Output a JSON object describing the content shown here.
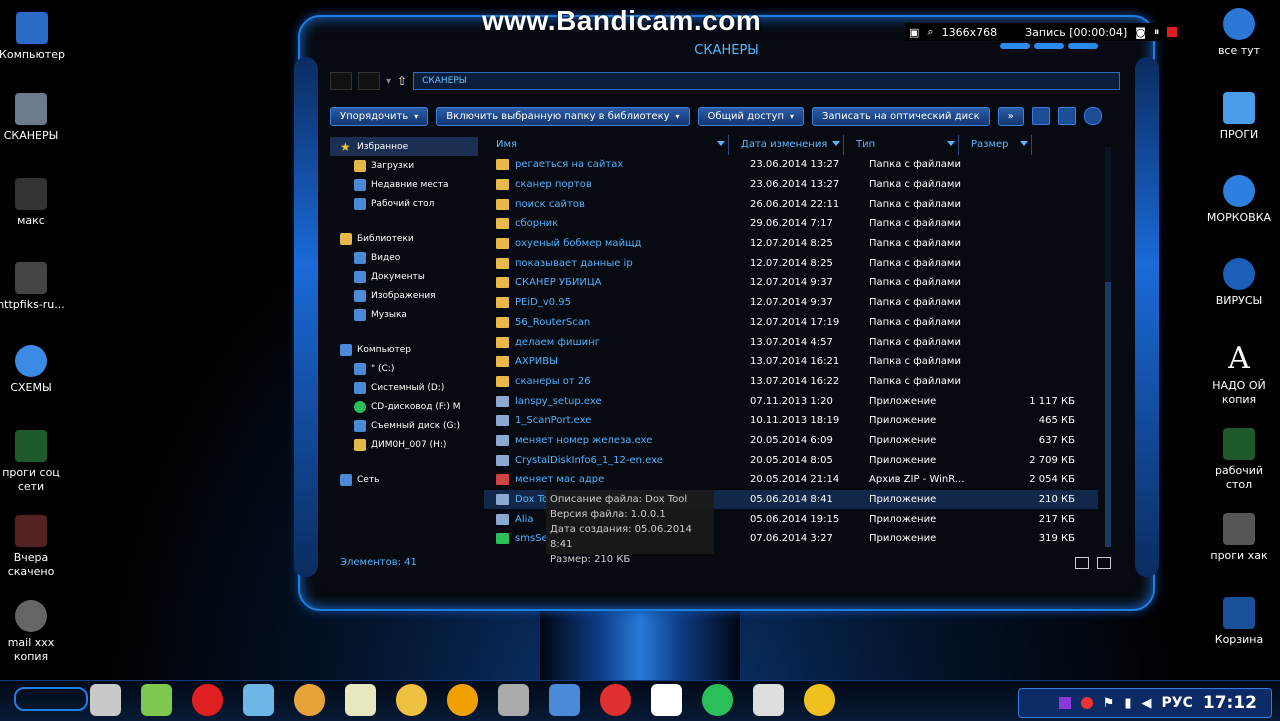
{
  "overlay": {
    "watermark": "www.Bandicam.com",
    "resolution": "1366x768",
    "recording": "Запись [00:00:04]"
  },
  "desktop_left": [
    {
      "label": "Компьютер",
      "icon": "computer-icon"
    },
    {
      "label": "СКАНЕРЫ",
      "icon": "folder-icon"
    },
    {
      "label": "макс",
      "icon": "folder-icon"
    },
    {
      "label": "httpfiks-ru...",
      "icon": "tool-icon"
    },
    {
      "label": "СХЕМЫ",
      "icon": "globe-icon"
    },
    {
      "label": "проги соц сети",
      "icon": "folder-icon"
    },
    {
      "label": "Вчера скачено",
      "icon": "folder-icon"
    },
    {
      "label": "mail xxx копия",
      "icon": "mail-icon"
    }
  ],
  "desktop_right": [
    {
      "label": "все тут",
      "icon": "windows-icon"
    },
    {
      "label": "ПРОГИ",
      "icon": "monitor-icon"
    },
    {
      "label": "МОРКОВКА",
      "icon": "globe-icon"
    },
    {
      "label": "ВИРУСЫ",
      "icon": "globe-icon"
    },
    {
      "label": "НАДО ОЙ копия",
      "icon": "font-icon"
    },
    {
      "label": "рабочий стол",
      "icon": "folder-icon"
    },
    {
      "label": "проги хак",
      "icon": "computer-icon"
    },
    {
      "label": "Корзина",
      "icon": "recycle-bin-icon"
    }
  ],
  "window": {
    "title": "СКАНЕРЫ",
    "address": "СКАНЕРЫ",
    "toolbar": {
      "organize": "Упорядочить",
      "include": "Включить выбранную папку в библиотеку",
      "share": "Общий доступ",
      "burn": "Записать на оптический диск",
      "more": "»"
    },
    "nav": {
      "favorites": "Избранное",
      "fav_items": [
        "Загрузки",
        "Недавние места",
        "Рабочий стол"
      ],
      "libraries": "Библиотеки",
      "lib_items": [
        "Видео",
        "Документы",
        "Изображения",
        "Музыка"
      ],
      "computer": "Компьютер",
      "comp_items": [
        "\" (C:)",
        "Системный (D:)",
        "CD-дисковод (F:) M",
        "Съемный диск (G:)",
        "ДИМ0Н_007 (H:)"
      ],
      "network": "Сеть"
    },
    "columns": {
      "name": "Имя",
      "date": "Дата изменения",
      "type": "Тип",
      "size": "Размер"
    },
    "rows": [
      {
        "name": "регаеться на сайтах",
        "date": "23.06.2014 13:27",
        "type": "Папка с файлами",
        "size": "",
        "icon": "folder-icon"
      },
      {
        "name": "сканер портов",
        "date": "23.06.2014 13:27",
        "type": "Папка с файлами",
        "size": "",
        "icon": "folder-icon"
      },
      {
        "name": "поиск сайтов",
        "date": "26.06.2014 22:11",
        "type": "Папка с файлами",
        "size": "",
        "icon": "folder-icon"
      },
      {
        "name": "сборник",
        "date": "29.06.2014 7:17",
        "type": "Папка с файлами",
        "size": "",
        "icon": "folder-icon"
      },
      {
        "name": "охуеный бобмер майщд",
        "date": "12.07.2014 8:25",
        "type": "Папка с файлами",
        "size": "",
        "icon": "folder-icon"
      },
      {
        "name": "показывает данные ip",
        "date": "12.07.2014 8:25",
        "type": "Папка с файлами",
        "size": "",
        "icon": "folder-icon"
      },
      {
        "name": "СКАНЕР УБИЙЦА",
        "date": "12.07.2014 9:37",
        "type": "Папка с файлами",
        "size": "",
        "icon": "folder-icon"
      },
      {
        "name": "PEiD_v0.95",
        "date": "12.07.2014 9:37",
        "type": "Папка с файлами",
        "size": "",
        "icon": "folder-icon"
      },
      {
        "name": "56_RouterScan",
        "date": "12.07.2014 17:19",
        "type": "Папка с файлами",
        "size": "",
        "icon": "folder-icon"
      },
      {
        "name": "делаем фишинг",
        "date": "13.07.2014 4:57",
        "type": "Папка с файлами",
        "size": "",
        "icon": "folder-icon"
      },
      {
        "name": "АХРИВЫ",
        "date": "13.07.2014 16:21",
        "type": "Папка с файлами",
        "size": "",
        "icon": "folder-icon"
      },
      {
        "name": "сканеры от 26",
        "date": "13.07.2014 16:22",
        "type": "Папка с файлами",
        "size": "",
        "icon": "folder-icon"
      },
      {
        "name": "lanspy_setup.exe",
        "date": "07.11.2013 1:20",
        "type": "Приложение",
        "size": "1 117 КБ",
        "icon": "app-icon"
      },
      {
        "name": "1_ScanPort.exe",
        "date": "10.11.2013 18:19",
        "type": "Приложение",
        "size": "465 КБ",
        "icon": "app-icon"
      },
      {
        "name": "меняет номер железа.exe",
        "date": "20.05.2014 6:09",
        "type": "Приложение",
        "size": "637 КБ",
        "icon": "app-icon"
      },
      {
        "name": "CrystalDiskInfo6_1_12-en.exe",
        "date": "20.05.2014 8:05",
        "type": "Приложение",
        "size": "2 709 КБ",
        "icon": "app-icon"
      },
      {
        "name": "меняет мас адре",
        "date": "20.05.2014 21:14",
        "type": "Архив ZIP - WinR...",
        "size": "2 054 КБ",
        "icon": "zip-icon"
      },
      {
        "name": "Dox To",
        "date": "05.06.2014 8:41",
        "type": "Приложение",
        "size": "210 КБ",
        "icon": "app-icon",
        "highlight": true
      },
      {
        "name": "Alia",
        "date": "05.06.2014 19:15",
        "type": "Приложение",
        "size": "217 КБ",
        "icon": "app-icon"
      },
      {
        "name": "smsSe",
        "date": "07.06.2014 3:27",
        "type": "Приложение",
        "size": "319 КБ",
        "icon": "green-icon"
      }
    ],
    "status": "Элементов: 41",
    "tooltip": [
      "Описание файла: Dox Tool",
      "Версия файла: 1.0.0.1",
      "Дата создания: 05.06.2014 8:41",
      "Размер: 210 КБ"
    ]
  },
  "taskbar": {
    "apps": [
      "paint-icon",
      "recycle-icon",
      "record-icon",
      "notepad-icon",
      "chrome-icon",
      "notepad-plus-icon",
      "lemon-icon",
      "avast-icon",
      "tanks-icon",
      "vsd-icon",
      "pinterest-icon",
      "font-icon",
      "mail-icon",
      "word-icon",
      "sun-icon"
    ],
    "lang": "РУС",
    "clock": "17:12"
  }
}
